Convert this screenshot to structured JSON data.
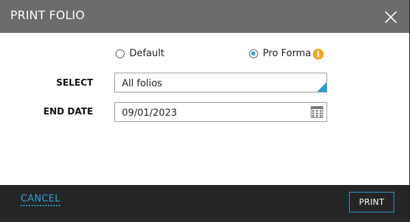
{
  "dialog": {
    "title": "PRINT FOLIO"
  },
  "format_options": [
    {
      "label": "Default",
      "selected": false
    },
    {
      "label": "Pro Forma",
      "selected": true
    }
  ],
  "info_icon_glyph": "i",
  "select_field": {
    "label": "SELECT",
    "value": "All folios"
  },
  "end_date_field": {
    "label": "END DATE",
    "value": "09/01/2023"
  },
  "footer": {
    "cancel_label": "CANCEL",
    "print_label": "PRINT"
  },
  "colors": {
    "header_bg": "#6b6b6b",
    "accent": "#2b9fd9",
    "info": "#f0a928",
    "footer_bg": "#252525"
  },
  "icons": {
    "close": "close-icon",
    "info": "info-icon",
    "calendar": "calendar-icon",
    "dropdown": "dropdown-triangle-icon"
  }
}
